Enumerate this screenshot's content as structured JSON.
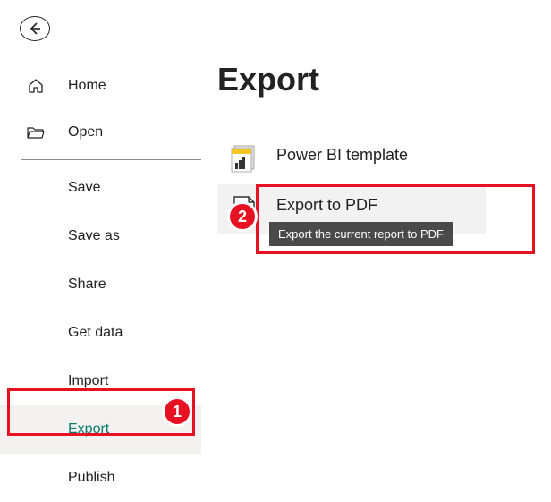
{
  "sidebar": {
    "top": [
      {
        "label": "Home"
      },
      {
        "label": "Open"
      }
    ],
    "sub": [
      {
        "label": "Save"
      },
      {
        "label": "Save as"
      },
      {
        "label": "Share"
      },
      {
        "label": "Get data"
      },
      {
        "label": "Import"
      },
      {
        "label": "Export"
      },
      {
        "label": "Publish"
      }
    ]
  },
  "main": {
    "title": "Export",
    "options": [
      {
        "label": "Power BI template"
      },
      {
        "label": "Export to PDF",
        "tooltip": "Export the current report to PDF"
      }
    ]
  },
  "callouts": {
    "one": "1",
    "two": "2"
  }
}
